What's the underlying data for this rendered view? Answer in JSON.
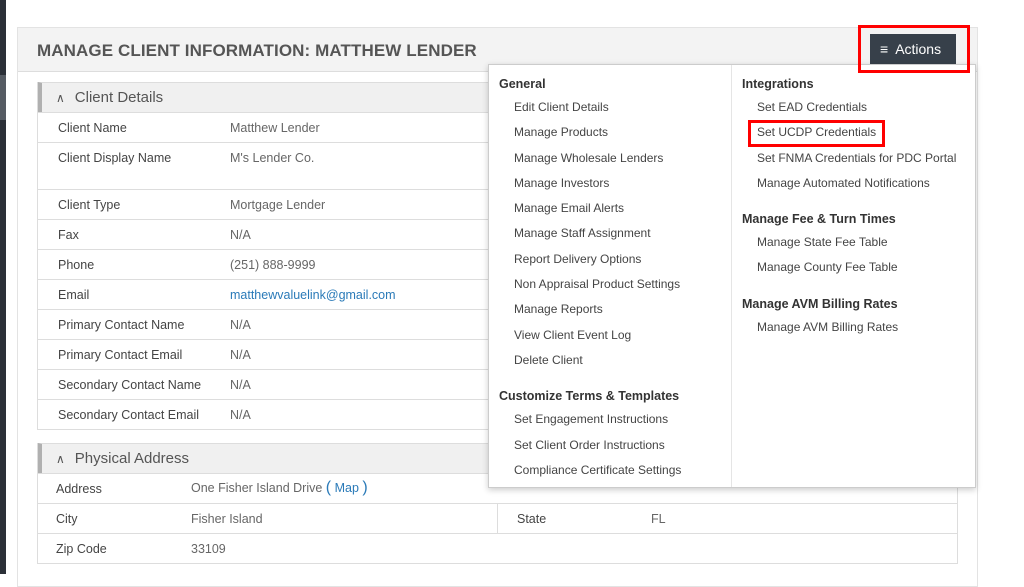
{
  "page_title": "MANAGE CLIENT INFORMATION: MATTHEW LENDER",
  "actions_label": "Actions",
  "client_details": {
    "title": "Client Details",
    "rows": [
      {
        "label": "Client Name",
        "value": "Matthew Lender"
      },
      {
        "label": "Client Display Name",
        "value": "M's Lender Co."
      },
      {
        "label": "Client Type",
        "value": "Mortgage Lender"
      },
      {
        "label": "Fax",
        "value": "N/A"
      },
      {
        "label": "Phone",
        "value": "(251) 888-9999"
      },
      {
        "label": "Email",
        "value": "matthewvaluelink@gmail.com"
      },
      {
        "label": "Primary Contact Name",
        "value": "N/A"
      },
      {
        "label": "Primary Contact Email",
        "value": "N/A"
      },
      {
        "label": "Secondary Contact Name",
        "value": "N/A"
      },
      {
        "label": "Secondary Contact Email",
        "value": "N/A"
      }
    ]
  },
  "physical_address": {
    "title": "Physical Address",
    "address_label": "Address",
    "address": "One Fisher Island Drive",
    "map_link": "Map",
    "paren_open": "(",
    "paren_close": ")",
    "city_label": "City",
    "city": "Fisher Island",
    "state_label": "State",
    "state": "FL",
    "zip_label": "Zip Code",
    "zip": "33109"
  },
  "menu": {
    "general": {
      "title": "General",
      "items": [
        "Edit Client Details",
        "Manage Products",
        "Manage Wholesale Lenders",
        "Manage Investors",
        "Manage Email Alerts",
        "Manage Staff Assignment",
        "Report Delivery Options",
        "Non Appraisal Product Settings",
        "Manage Reports",
        "View Client Event Log",
        "Delete Client"
      ]
    },
    "customize": {
      "title": "Customize Terms & Templates",
      "items": [
        "Set Engagement Instructions",
        "Set Client Order Instructions",
        "Compliance Certificate Settings"
      ]
    },
    "integrations": {
      "title": "Integrations",
      "items": [
        "Set EAD Credentials",
        "Set UCDP Credentials",
        "Set FNMA Credentials for PDC Portal",
        "Manage Automated Notifications"
      ]
    },
    "fees": {
      "title": "Manage Fee & Turn Times",
      "items": [
        "Manage State Fee Table",
        "Manage County Fee Table"
      ]
    },
    "avm": {
      "title": "Manage AVM Billing Rates",
      "items": [
        "Manage AVM Billing Rates"
      ]
    }
  },
  "colors": {
    "highlight": "#ff0000",
    "button": "#37404a",
    "link": "#2a7ab8"
  }
}
